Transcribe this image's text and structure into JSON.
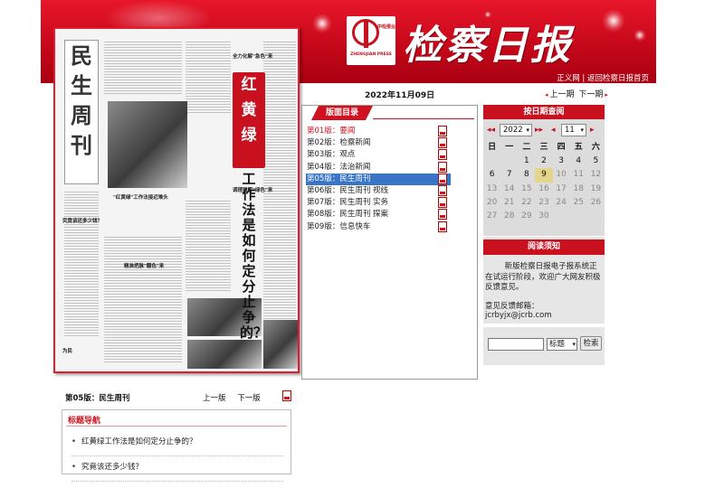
{
  "banner": {
    "masthead": "检察日报",
    "logo_small": "中检报业",
    "logo_en": "ZHENGJIAN PRESS",
    "links": [
      "正义网",
      "返回检察日报首页"
    ]
  },
  "thumbnail": {
    "section_chars": [
      "民",
      "生",
      "周",
      "刊"
    ],
    "red_title_chars": [
      "红",
      "黄",
      "绿"
    ],
    "sub_title": "工作法是如何定分止争的？",
    "captions": [
      "全力化解\"急色\"来",
      "\"红黄绿\"工作法接近难头",
      "精准把脉\"翻色\"来",
      "调理和解\"绿色\"来",
      "究竟该还多少钱？",
      "为民"
    ]
  },
  "date_label": "2022年11月09日",
  "page_nav": {
    "prev": "上一期",
    "next": "下一期"
  },
  "toc": {
    "title": "版面目录",
    "items": [
      "第01版：要闻",
      "第02版：检察新闻",
      "第03版：观点",
      "第04版：法治新闻",
      "第05版：民生周刊",
      "第06版：民生周刊 视线",
      "第07版：民生周刊 实务",
      "第08版：民生周刊 探案",
      "第09版：信息快车"
    ]
  },
  "calendar": {
    "title": "按日期查阅",
    "year": "2022",
    "month": "11",
    "weekdays": [
      "日",
      "一",
      "二",
      "三",
      "四",
      "五",
      "六"
    ],
    "weeks": [
      [
        "",
        "",
        "1",
        "2",
        "3",
        "4",
        "5"
      ],
      [
        "6",
        "7",
        "8",
        "9",
        "10",
        "11",
        "12"
      ],
      [
        "13",
        "14",
        "15",
        "16",
        "17",
        "18",
        "19"
      ],
      [
        "20",
        "21",
        "22",
        "23",
        "24",
        "25",
        "26"
      ],
      [
        "27",
        "28",
        "29",
        "30",
        "",
        "",
        ""
      ]
    ],
    "today": "9"
  },
  "notice": {
    "title": "阅读须知",
    "text": "新版检察日报电子报系统正在试运行阶段，欢迎广大网友积极反馈意见。",
    "mail": "意见反馈邮箱：jcrbyjx@jcrb.com"
  },
  "search": {
    "select": "标题",
    "button": "检索"
  },
  "current_page": {
    "label": "第05版：民生周刊",
    "prev": "上一版",
    "next": "下一版"
  },
  "headline_nav": {
    "title": "标题导航",
    "items": [
      "红黄绿工作法是如何定分止争的？",
      "究竟该还多少钱？"
    ]
  }
}
